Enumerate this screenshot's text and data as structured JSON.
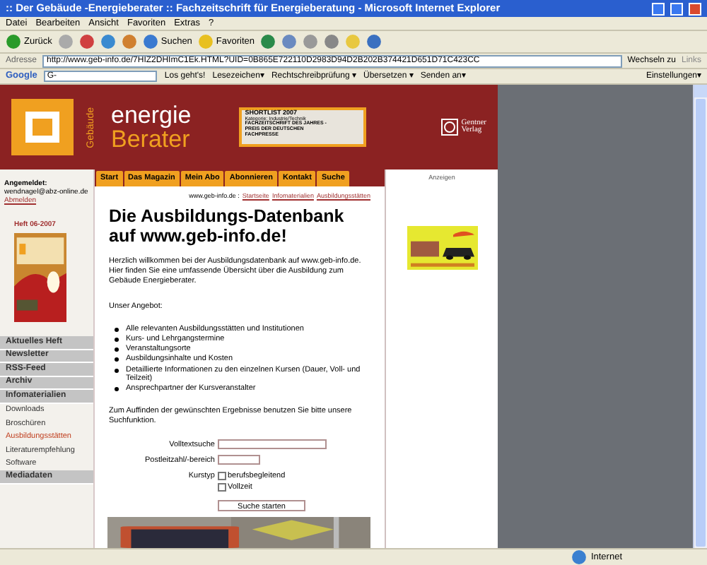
{
  "window": {
    "title": ":: Der Gebäude -Energieberater :: Fachzeitschrift für Energieberatung - Microsoft Internet Explorer"
  },
  "menu": [
    "Datei",
    "Bearbeiten",
    "Ansicht",
    "Favoriten",
    "Extras",
    "?"
  ],
  "toolbar": {
    "back": "Zurück",
    "search": "Suchen",
    "favorites": "Favoriten"
  },
  "address_bar": {
    "label": "Adresse",
    "url": "http://www.geb-info.de/7HIZ2DHImC1Ek.HTML?UID=0B865E722110D2983D94D2B202B374421D651D71C423CC",
    "go": "Wechseln zu",
    "links": "Links"
  },
  "google_toolbar": {
    "brand": "Google",
    "search": "G-",
    "go": "Los geht's!",
    "items": [
      "Lesezeichen▾",
      "Rechtschreibprüfung ▾",
      "Übersetzen ▾",
      "Senden an▾"
    ],
    "settings": "Einstellungen▾"
  },
  "header": {
    "brand_vertical": "Gebäude",
    "brand_top": "energie",
    "brand_bottom": "Berater",
    "badge": {
      "title": "SHORTLIST 2007",
      "category": "Kategorie: Industrie/Technik",
      "text": "FACHZEITSCHRIFT DES JAHRES - PREIS DER DEUTSCHEN FACHPRESSE"
    },
    "publisher": [
      "Gentner",
      "Verlag"
    ]
  },
  "nav_tabs": [
    "Start",
    "Das Magazin",
    "Mein Abo",
    "Abonnieren",
    "Kontakt",
    "Suche"
  ],
  "sidebar": {
    "login_label": "Angemeldet:",
    "email": "wendnagel@abz-online.de",
    "logout": "Abmelden",
    "issue": "Heft 06-2007",
    "items": [
      {
        "label": "Aktuelles Heft",
        "kind": "section",
        "selected": false
      },
      {
        "label": "Newsletter",
        "kind": "section",
        "selected": false
      },
      {
        "label": "RSS-Feed",
        "kind": "section",
        "selected": false
      },
      {
        "label": "Archiv",
        "kind": "section",
        "selected": false
      },
      {
        "label": "Infomaterialien",
        "kind": "section",
        "selected": false
      },
      {
        "label": "Downloads",
        "kind": "link",
        "selected": false
      },
      {
        "label": "Broschüren",
        "kind": "link",
        "selected": false
      },
      {
        "label": "Ausbildungsstätten",
        "kind": "link",
        "selected": true
      },
      {
        "label": "Literaturempfehlung",
        "kind": "link",
        "selected": false
      },
      {
        "label": "Software",
        "kind": "link",
        "selected": false
      },
      {
        "label": "Mediadaten",
        "kind": "section",
        "selected": false
      }
    ]
  },
  "breadcrumb": {
    "site": "www.geb-info.de :",
    "links": [
      "Startseite",
      "Infomaterialien",
      "Ausbildungsstätten"
    ]
  },
  "main": {
    "heading": "Die Ausbildungs-Datenbank auf www.geb-info.de!",
    "intro": "Herzlich willkommen bei der Ausbildungsdatenbank auf www.geb-info.de. Hier finden Sie eine umfassende Übersicht über die Ausbildung zum Gebäude Energieberater.",
    "offer_label": "Unser Angebot:",
    "offers": [
      "Alle relevanten Ausbildungsstätten und Institutionen",
      "Kurs- und Lehrgangstermine",
      "Veranstaltungsorte",
      "Ausbildungsinhalte und Kosten",
      "Detaillierte Informationen zu den einzelnen Kursen (Dauer, Voll- und Teilzeit)",
      "Ansprechpartner der Kursveranstalter"
    ],
    "hint": "Zum Auffinden der gewünschten Ergebnisse benutzen Sie bitte unsere Suchfunktion.",
    "form": {
      "fulltext_label": "Volltextsuche",
      "zip_label": "Postleitzahl/-bereich",
      "type_label": "Kurstyp",
      "options": [
        {
          "label": "berufsbegleitend",
          "checked": false
        },
        {
          "label": "Vollzeit",
          "checked": false
        }
      ],
      "submit": "Suche starten"
    }
  },
  "ads": {
    "label": "Anzeigen"
  },
  "status_bar": {
    "zone": "Internet"
  }
}
